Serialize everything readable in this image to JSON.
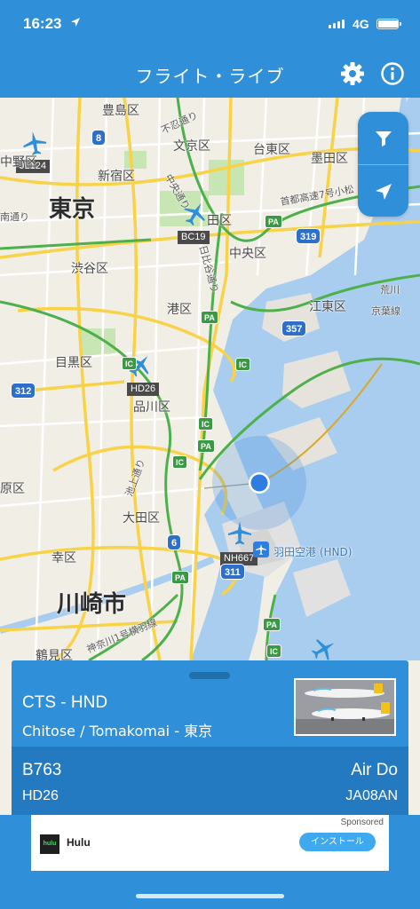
{
  "status_bar": {
    "time": "16:23",
    "network": "4G",
    "battery_level": 0.95,
    "signal_bars": 4,
    "icons": [
      "location-arrow-icon",
      "signal-icon",
      "battery-icon"
    ]
  },
  "nav": {
    "title": "フライト・ライブ",
    "icons": [
      "gear-icon",
      "info-icon"
    ]
  },
  "map": {
    "labels": {
      "toshima": "豊島区",
      "bunkyo": "文京区",
      "taito": "台東区",
      "sumida": "墨田区",
      "shinjuku": "新宿区",
      "nakano": "中野区",
      "tokyo": "東京",
      "chiyoda": "田区",
      "chuo": "中央区",
      "shibuya": "渋谷区",
      "minato": "港区",
      "koto": "江東区",
      "meguro": "目黒区",
      "shinagawa": "品川区",
      "ota": "大田区",
      "setagaya": "原区",
      "saiwai": "幸区",
      "kawasaki": "川崎市",
      "tsurumi": "鶴見区",
      "haneda": "羽田空港 (HND)",
      "shinobazu": "不忍通り",
      "minami": "南通り",
      "hibiya": "日比谷通り",
      "ikegami": "池上通り",
      "shuto7": "首都高速7号小松",
      "keiyo": "京葉線",
      "arakawa": "荒川",
      "kanagawa": "神奈川1号横羽線",
      "nakadori": "中央通り"
    },
    "route_shields": [
      "8",
      "319",
      "357",
      "312",
      "6",
      "311"
    ],
    "ic_badges": [
      "PA",
      "PA",
      "IC",
      "IC",
      "IC",
      "PA",
      "IC",
      "PA",
      "PA",
      "IC"
    ],
    "flight_tags": [
      "JL124",
      "BC19",
      "HD26",
      "NH667"
    ],
    "controls": [
      "filter-icon",
      "location-icon"
    ]
  },
  "flight": {
    "route": "CTS - HND",
    "cities": "Chitose / Tomakomai - 東京",
    "aircraft": "B763",
    "airline": "Air Do",
    "flight_number": "HD26",
    "registration": "JA08AN",
    "accent": "#2f8fd8"
  },
  "ad": {
    "sponsored": "Sponsored",
    "logo_text": "hulu",
    "app_name": "Hulu",
    "install_label": "インストール"
  }
}
